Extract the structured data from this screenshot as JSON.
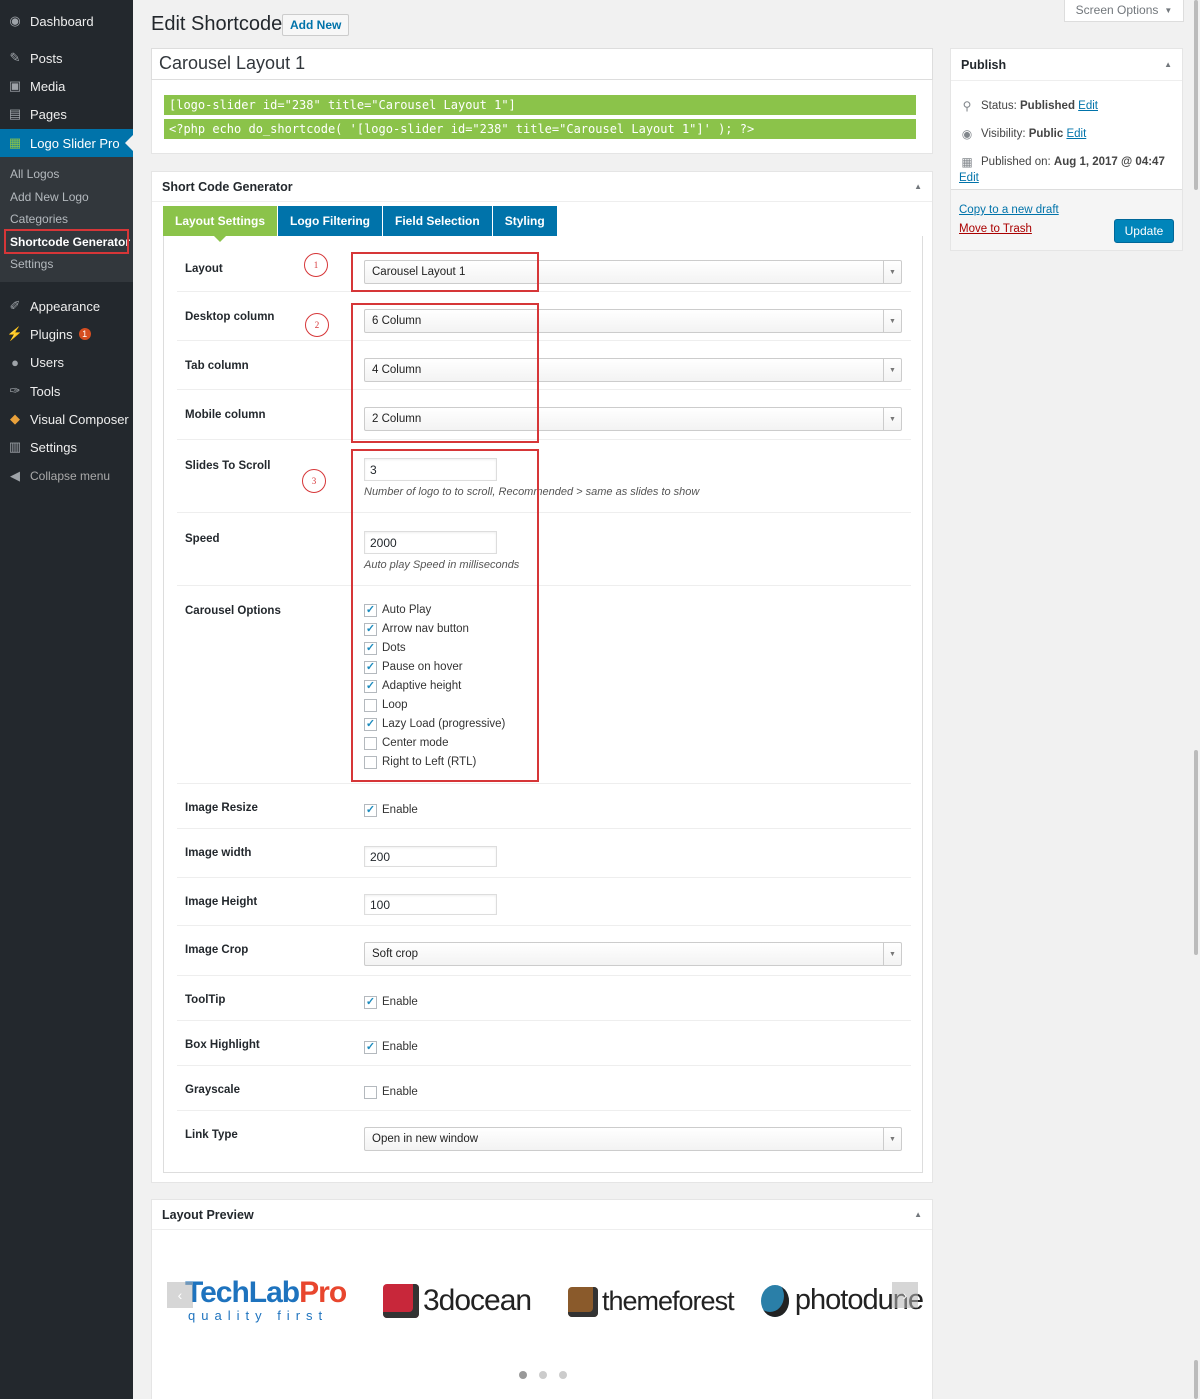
{
  "sidebar": {
    "menu": [
      {
        "label": "Dashboard",
        "icon": "dashboard-icon"
      },
      {
        "label": "Posts",
        "icon": "pin-icon"
      },
      {
        "label": "Media",
        "icon": "media-icon"
      },
      {
        "label": "Pages",
        "icon": "pages-icon"
      },
      {
        "label": "Logo Slider Pro",
        "icon": "grid-icon"
      },
      {
        "label": "Appearance",
        "icon": "brush-icon"
      },
      {
        "label": "Plugins",
        "icon": "plug-icon",
        "badge": "1"
      },
      {
        "label": "Users",
        "icon": "user-icon"
      },
      {
        "label": "Tools",
        "icon": "wrench-icon"
      },
      {
        "label": "Visual Composer",
        "icon": "vc-icon"
      },
      {
        "label": "Settings",
        "icon": "settings-icon"
      }
    ],
    "submenu": [
      "All Logos",
      "Add New Logo",
      "Categories",
      "Shortcode Generator",
      "Settings"
    ],
    "collapse": "Collapse menu"
  },
  "screen_options": "Screen Options",
  "header": {
    "title": "Edit Shortcode",
    "add_new": "Add New"
  },
  "post_title": "Carousel Layout 1",
  "shortcodes": {
    "line1": "[logo-slider id=\"238\" title=\"Carousel Layout 1\"]",
    "line2": "<?php echo do_shortcode( '[logo-slider id=\"238\" title=\"Carousel Layout 1\"]' ); ?>"
  },
  "generator": {
    "title": "Short Code Generator",
    "tabs": [
      "Layout Settings",
      "Logo Filtering",
      "Field Selection",
      "Styling"
    ],
    "layout": {
      "label": "Layout",
      "value": "Carousel Layout 1"
    },
    "desktop": {
      "label": "Desktop column",
      "value": "6 Column"
    },
    "tab": {
      "label": "Tab column",
      "value": "4 Column"
    },
    "mobile": {
      "label": "Mobile column",
      "value": "2 Column"
    },
    "slides": {
      "label": "Slides To Scroll",
      "value": "3",
      "help": "Number of logo to to scroll, Recommended > same as slides to show"
    },
    "speed": {
      "label": "Speed",
      "value": "2000",
      "help": "Auto play Speed in milliseconds"
    },
    "carousel": {
      "label": "Carousel Options",
      "options": [
        {
          "label": "Auto Play",
          "checked": true
        },
        {
          "label": "Arrow nav button",
          "checked": true
        },
        {
          "label": "Dots",
          "checked": true
        },
        {
          "label": "Pause on hover",
          "checked": true
        },
        {
          "label": "Adaptive height",
          "checked": true
        },
        {
          "label": "Loop",
          "checked": false
        },
        {
          "label": "Lazy Load (progressive)",
          "checked": true
        },
        {
          "label": "Center mode",
          "checked": false
        },
        {
          "label": "Right to Left (RTL)",
          "checked": false
        }
      ]
    },
    "image_resize": {
      "label": "Image Resize",
      "option": "Enable",
      "checked": true
    },
    "image_width": {
      "label": "Image width",
      "value": "200"
    },
    "image_height": {
      "label": "Image Height",
      "value": "100"
    },
    "image_crop": {
      "label": "Image Crop",
      "value": "Soft crop"
    },
    "tooltip": {
      "label": "ToolTip",
      "option": "Enable",
      "checked": true
    },
    "box_highlight": {
      "label": "Box Highlight",
      "option": "Enable",
      "checked": true
    },
    "grayscale": {
      "label": "Grayscale",
      "option": "Enable",
      "checked": false
    },
    "link_type": {
      "label": "Link Type",
      "value": "Open in new window"
    },
    "annotations": [
      "1",
      "2",
      "3"
    ]
  },
  "publish": {
    "title": "Publish",
    "status_label": "Status:",
    "status": "Published",
    "edit": "Edit",
    "visibility_label": "Visibility:",
    "visibility": "Public",
    "published_label": "Published on:",
    "published": "Aug 1, 2017 @ 04:47",
    "copy_draft": "Copy to a new draft",
    "trash": "Move to Trash",
    "update": "Update"
  },
  "preview": {
    "title": "Layout Preview",
    "logos": [
      {
        "name": "TechLabPro",
        "part1": "Tech",
        "part2": "Lab",
        "part3": "Pro",
        "tagline": "quality first"
      },
      {
        "name": "3docean"
      },
      {
        "name": "themeforest"
      },
      {
        "name": "photodune"
      }
    ],
    "dots": 3
  },
  "colors": {
    "sidebar": "#23282d",
    "active": "#0073aa",
    "green": "#8bc34a",
    "annotation": "#d63638"
  }
}
